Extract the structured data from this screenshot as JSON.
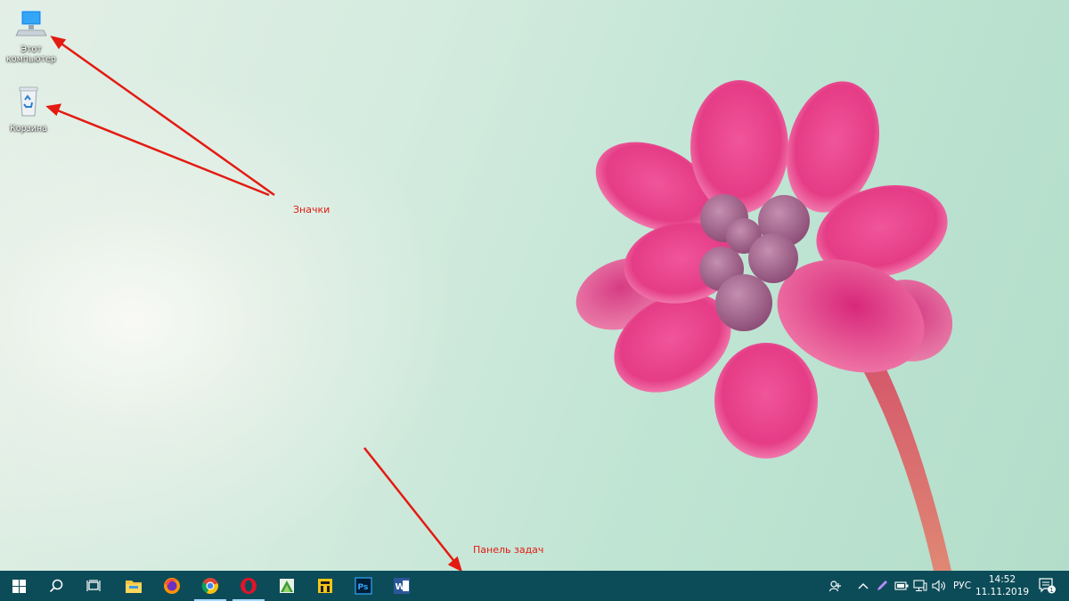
{
  "desktop": {
    "icons": [
      {
        "label_line1": "Этот",
        "label_line2": "компьютер",
        "icon": "this-pc-icon"
      },
      {
        "label": "Корзина",
        "icon": "recycle-bin-icon"
      }
    ],
    "annotations": {
      "icons_label": "Значки",
      "taskbar_label": "Панель задач"
    },
    "colors": {
      "annotation": "#e31b12",
      "wallpaper_accent": "#e8488a"
    }
  },
  "taskbar": {
    "color": "#0c4c58",
    "buttons": [
      {
        "icon": "windows-start-icon"
      },
      {
        "icon": "search-icon"
      },
      {
        "icon": "task-view-icon"
      }
    ],
    "apps": [
      {
        "icon": "file-explorer-icon"
      },
      {
        "icon": "firefox-icon"
      },
      {
        "icon": "chrome-icon"
      },
      {
        "icon": "opera-icon"
      },
      {
        "icon": "green-app-icon"
      },
      {
        "icon": "yellow-app-icon"
      },
      {
        "icon": "photoshop-icon",
        "text": "Ps"
      },
      {
        "icon": "word-icon",
        "text": "W"
      }
    ],
    "tray": {
      "icons": [
        "people-icon",
        "chevron-up-icon",
        "pen-icon",
        "battery-icon",
        "network-icon",
        "volume-icon"
      ],
      "language": "РУС",
      "time": "14:52",
      "date": "11.11.2019",
      "notification_count": "1"
    }
  }
}
